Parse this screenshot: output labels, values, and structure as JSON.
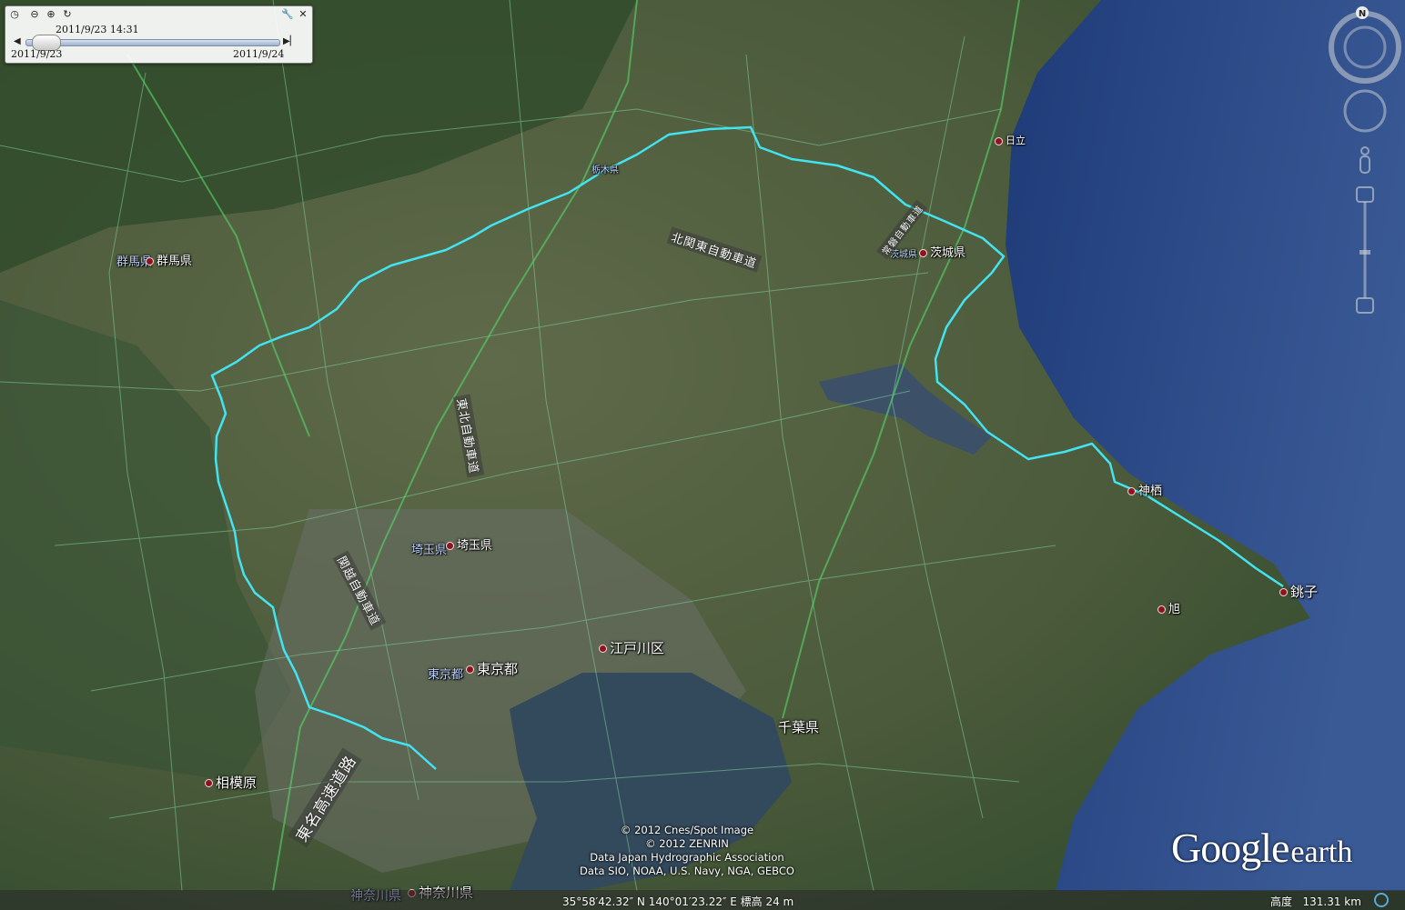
{
  "timebar": {
    "current_time": "2011/9/23  14:31",
    "start_date": "2011/9/23",
    "end_date": "2011/9/24",
    "handle_position": 0.04
  },
  "navigation": {
    "compass_label": "N"
  },
  "places": {
    "gunma_label": "群馬県",
    "gunma_label_alt": "群馬県",
    "tochigi_label": "栃木県",
    "ibaraki_label": "茨城県",
    "ibaraki_label_alt": "茨城県",
    "hitachi_label": "日立",
    "saitama_label": "埼玉県",
    "saitama_label_alt": "埼玉県",
    "tokyo_label": "東京都",
    "tokyo_label_alt": "東京都",
    "edogawa_label": "江戸川区",
    "chiba_label": "千葉県",
    "sagamihara_label": "相模原",
    "kanagawa_label": "神奈川県",
    "kanagawa_label_alt": "神奈川県",
    "kamisu_label": "神栖",
    "choshi_label": "銚子",
    "asahi_label": "旭"
  },
  "roads": {
    "tohoku_expressway": "東北自動車道",
    "kitakanto_expressway": "北関東自動車道",
    "kanetsu_expressway": "関越自動車道",
    "tomei_expressway": "東名高速道路",
    "joban_expressway": "常磐自動車道"
  },
  "credits": {
    "line1": "© 2012 Cnes/Spot Image",
    "line2": "© 2012 ZENRIN",
    "line3": "Data Japan Hydrographic Association",
    "line4": "Data SIO, NOAA, U.S. Navy, NGA, GEBCO"
  },
  "logo": {
    "google": "Google",
    "earth": "earth"
  },
  "status": {
    "coordinates": "35°58′42.32″ N 140°01′23.22″ E 標高    24 m",
    "altitude_label": "高度",
    "altitude_value": "131.31 km"
  },
  "colors": {
    "track": "#43e3f0",
    "ocean": "#27457f",
    "land": "#4d5e3c",
    "boundary": "#7fd0a0"
  }
}
